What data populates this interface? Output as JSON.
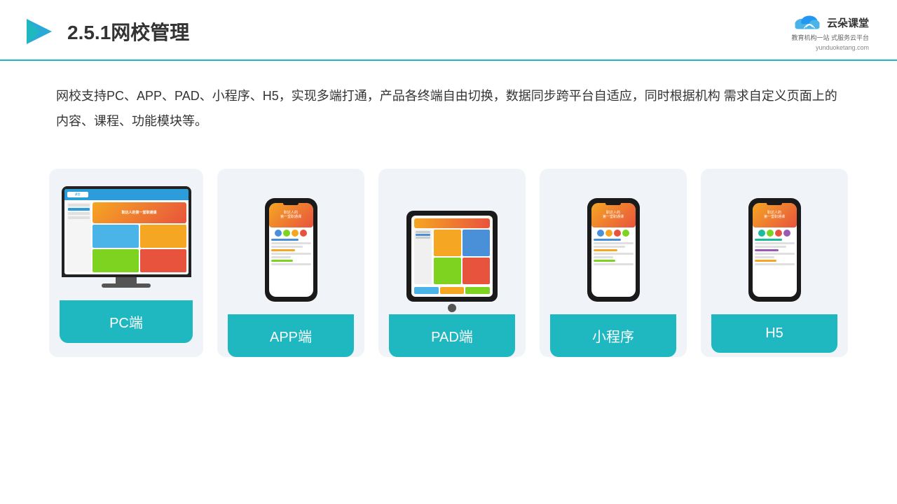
{
  "header": {
    "title": "2.5.1网校管理",
    "brand_name": "云朵课堂",
    "brand_url": "yunduoketang.com",
    "brand_tagline": "教育机构一站\n式服务云平台"
  },
  "description": "网校支持PC、APP、PAD、小程序、H5，实现多端打通，产品各终端自由切换，数据同步跨平台自适应，同时根据机构\n需求自定义页面上的内容、课程、功能模块等。",
  "cards": [
    {
      "id": "pc",
      "label": "PC端"
    },
    {
      "id": "app",
      "label": "APP端"
    },
    {
      "id": "pad",
      "label": "PAD端"
    },
    {
      "id": "mini",
      "label": "小程序"
    },
    {
      "id": "h5",
      "label": "H5"
    }
  ],
  "colors": {
    "accent": "#1fb8c1",
    "header_border": "#1fb8c1",
    "card_bg": "#f0f4f8",
    "badge_bg": "#1fb8c1",
    "badge_text": "#ffffff"
  }
}
